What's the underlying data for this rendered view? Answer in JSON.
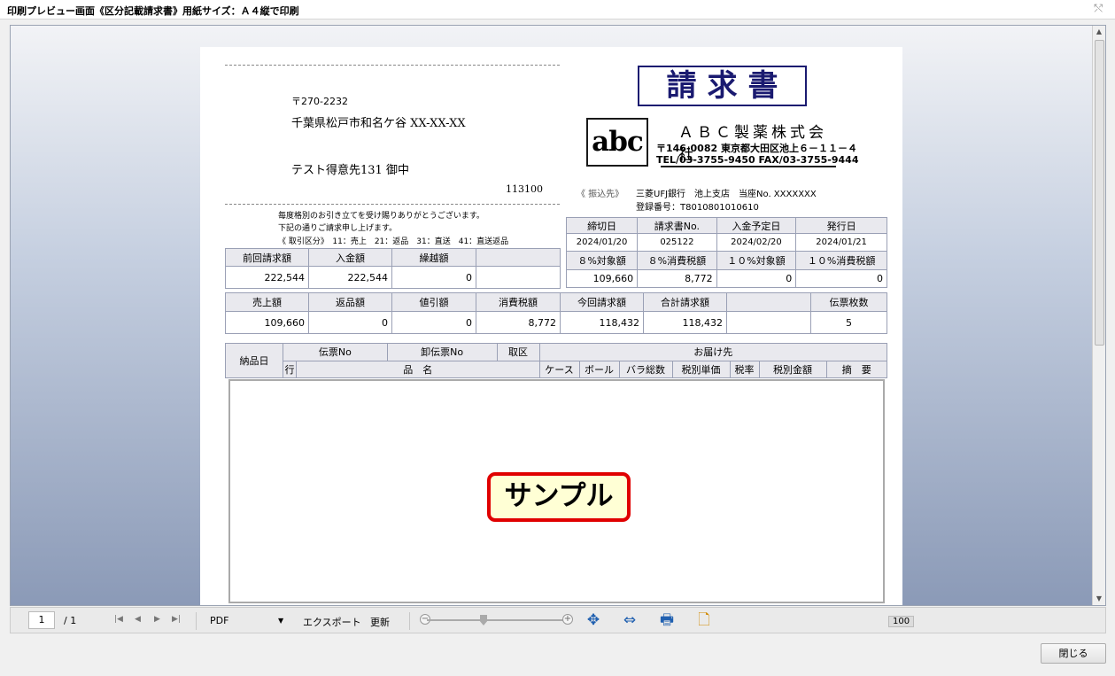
{
  "window": {
    "title": "印刷プレビュー画面《区分記載請求書》用紙サイズ：Ａ４縦で印刷",
    "close_icon": "⤲"
  },
  "invoice": {
    "postal": "〒270-2232",
    "address": "千葉県松戸市和名ケ谷 XX-XX-XX",
    "customer": "テスト得意先131 御中",
    "customer_code": "113100",
    "title": "請求書",
    "logo_text": "abc",
    "company_name": "ＡＢＣ製薬株式会社",
    "company_address": "〒146-0082 東京都大田区池上６－１１－４",
    "company_tel": "TEL/03-3755-9450 FAX/03-3755-9444",
    "bank_label": "《 振込先》",
    "bank": "三菱UFJ銀行　池上支店　当座No. XXXXXXX",
    "registration": "登録番号：T8010801010610",
    "greeting1": "毎度格別のお引き立てを受け賜りありがとうございます。",
    "greeting2": "下記の通りご請求申し上げます。",
    "trade_types": "《 取引区分》　11：売上　21：返品　31：直送　41：直送返品"
  },
  "info_table": {
    "row1_headers": [
      "締切日",
      "請求書No.",
      "入金予定日",
      "発行日"
    ],
    "row1_values": [
      "2024/01/20",
      "025122",
      "2024/02/20",
      "2024/01/21"
    ],
    "row2_headers": [
      "８%対象額",
      "８%消費税額",
      "１０%対象額",
      "１０%消費税額"
    ],
    "row2_values": [
      "109,660",
      "8,772",
      "0",
      "0"
    ]
  },
  "prev_table": {
    "headers": [
      "前回請求額",
      "入金額",
      "繰越額",
      ""
    ],
    "values": [
      "222,544",
      "222,544",
      "0",
      ""
    ]
  },
  "sales_table": {
    "headers": [
      "売上額",
      "返品額",
      "値引額",
      "消費税額",
      "今回請求額",
      "合計請求額",
      "",
      "伝票枚数"
    ],
    "values": [
      "109,660",
      "0",
      "0",
      "8,772",
      "118,432",
      "118,432",
      "",
      "5"
    ]
  },
  "detail_header": {
    "date": "納品日",
    "slip_no": "伝票No",
    "wholesale_slip_no": "卸伝票No",
    "trade_type": "取区",
    "delivery": "お届け先",
    "line": "行",
    "item_name": "品　名",
    "case": "ケース",
    "ball": "ボール",
    "pieces": "バラ総数",
    "unit_price": "税別単価",
    "tax_rate": "税率",
    "amount": "税別金額",
    "remarks": "摘　要"
  },
  "sample_label": "サンプル",
  "toolbar": {
    "page": "1",
    "page_total": "/ 1",
    "first_icon": "|◀",
    "prev_icon": "◀",
    "next_icon": "▶",
    "last_icon": "▶|",
    "format": "PDF",
    "format_arrow": "▼",
    "export": "エクスポート",
    "refresh": "更新",
    "zoom": "100",
    "zoom_out": "−",
    "zoom_in": "+",
    "fit_page_icon": "✥",
    "fit_width_icon": "⇔",
    "print_icon": "🖶",
    "page_setup_icon": "🗋"
  },
  "close_button": "閉じる"
}
